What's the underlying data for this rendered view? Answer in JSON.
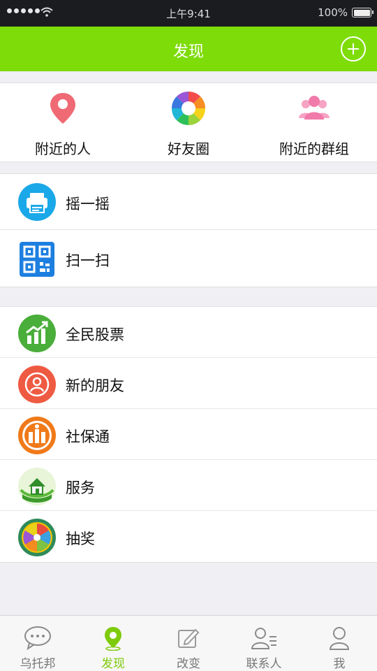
{
  "status_bar": {
    "time": "上午9:41",
    "battery": "100%"
  },
  "header": {
    "title": "发现"
  },
  "top_grid": [
    {
      "label": "附近的人",
      "icon": "location-pin-icon"
    },
    {
      "label": "好友圈",
      "icon": "color-aperture-icon"
    },
    {
      "label": "附近的群组",
      "icon": "group-people-icon"
    }
  ],
  "group1": [
    {
      "label": "摇一摇",
      "icon": "shake-printer-icon"
    },
    {
      "label": "扫一扫",
      "icon": "qr-scan-icon"
    }
  ],
  "group2": [
    {
      "label": "全民股票",
      "icon": "stock-chart-icon"
    },
    {
      "label": "新的朋友",
      "icon": "new-friend-icon"
    },
    {
      "label": "社保通",
      "icon": "social-security-icon"
    },
    {
      "label": "服务",
      "icon": "service-house-icon"
    },
    {
      "label": "抽奖",
      "icon": "lottery-wheel-icon"
    }
  ],
  "tabs": [
    {
      "label": "乌托邦",
      "icon": "chat-bubble-icon"
    },
    {
      "label": "发现",
      "icon": "discover-pin-icon",
      "active": true
    },
    {
      "label": "改变",
      "icon": "edit-icon"
    },
    {
      "label": "联系人",
      "icon": "contacts-icon"
    },
    {
      "label": "我",
      "icon": "person-icon"
    }
  ],
  "colors": {
    "accent": "#7edc08",
    "active_tab": "#7ecb0c",
    "background": "#efeff4"
  }
}
